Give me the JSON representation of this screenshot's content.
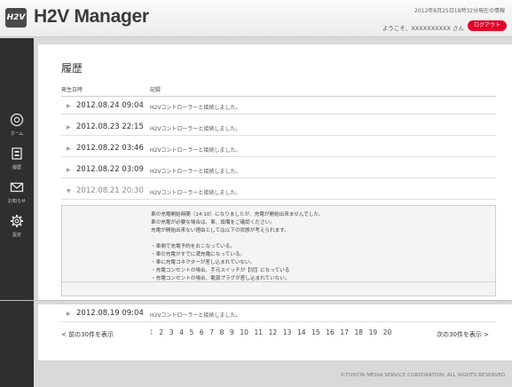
{
  "header": {
    "logo_text": "H2V",
    "title": "H2V Manager",
    "datetime": "2012年8月25日18時32分現在の情報",
    "greeting": "ようこそ、XXXXXXXXXX さん",
    "logout_label": "ログアウト",
    "logout_color": "#e1002a"
  },
  "sidebar": {
    "items": [
      {
        "icon": "home-icon",
        "label": "ホーム"
      },
      {
        "icon": "history-icon",
        "label": "履歴"
      },
      {
        "icon": "mail-icon",
        "label": "お知らせ"
      },
      {
        "icon": "gear-icon",
        "label": "設定"
      }
    ]
  },
  "main": {
    "title": "履歴",
    "columns": {
      "date": "発生日時",
      "record": "記録"
    },
    "rows": [
      {
        "date": "2012.08.24 09:04",
        "record": "H2Vコントローラーと接続しました。"
      },
      {
        "date": "2012.08.23 22:15",
        "record": "H2Vコントローラーと接続しました。"
      },
      {
        "date": "2012.08.22 03:46",
        "record": "H2Vコントローラーと接続しました。"
      },
      {
        "date": "2012.08.22 03:09",
        "record": "H2Vコントローラーと接続しました。"
      },
      {
        "date": "2012.08.21 20:30",
        "record": "H2Vコントローラーと接続しました。"
      }
    ],
    "detail_lines": [
      "車の充電開始時間（14:10）になりましたが、充電が開始出来ませんでした。",
      "車の充電が必要な場合は、車、設備をご確認ください。",
      "充電が開始出来ない理由としては以下の状態が考えられます。",
      "・車側で充電予約をおこなっている。",
      "・車の充電がすでに満充電になっている。",
      "・車に充電コネクターが差し込まれていない。",
      "・充電コンセントの場合、手元スイッチが【切】になっている",
      "・充電コンセントの場合、電源プラグが差し込まれていない。"
    ],
    "lower_row": {
      "date": "2012.08.19 09:04",
      "record": "H2Vコントローラーと接続しました。"
    }
  },
  "pager": {
    "prev": "< 前の30件を表示",
    "next": "次の30件を表示 >",
    "pages": [
      "1",
      "2",
      "3",
      "4",
      "5",
      "6",
      "7",
      "8",
      "9",
      "10",
      "11",
      "12",
      "13",
      "14",
      "15",
      "16",
      "17",
      "18",
      "19",
      "20"
    ]
  },
  "footer": {
    "copyright": "©TOYOTA MEDIA SERVICE CORPORATION. ALL RIGHTS RESERVED."
  }
}
